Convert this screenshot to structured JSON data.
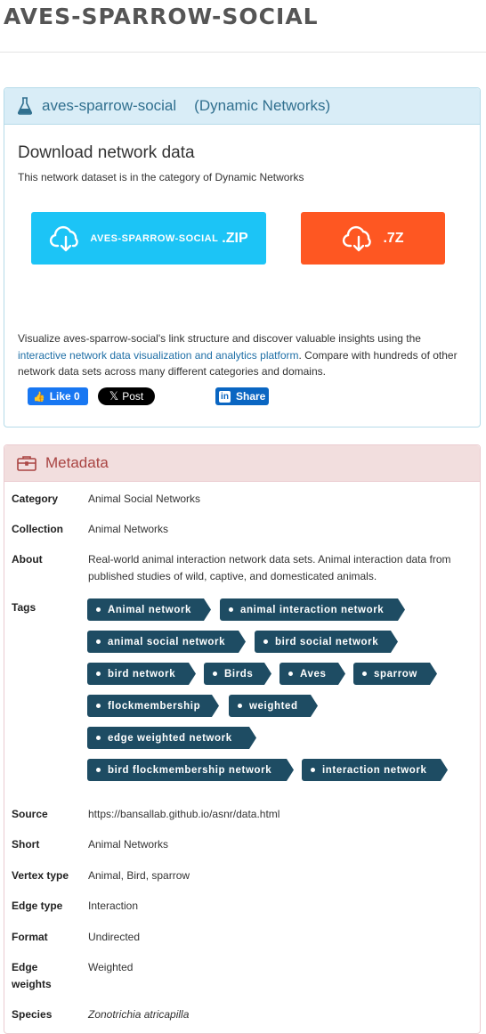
{
  "page": {
    "title": "AVES-SPARROW-SOCIAL"
  },
  "download": {
    "header_name": "aves-sparrow-social",
    "header_category": "(Dynamic Networks)",
    "title": "Download network data",
    "description": "This network dataset is in the category of Dynamic Networks",
    "zip_label": "AVES-SPARROW-SOCIAL",
    "zip_ext": ".ZIP",
    "sevenz_ext": ".7Z",
    "viz_prefix": "Visualize aves-sparrow-social's link structure and discover valuable insights using the",
    "viz_link": "interactive network data visualization and analytics platform",
    "viz_suffix": ". Compare with hundreds of other network data sets across many different categories and domains.",
    "fb_label": "Like 0",
    "tw_label": "Post",
    "li_label": "Share",
    "colors": {
      "zip": "#1cc4f6",
      "sevenz": "#fe5722"
    }
  },
  "metadata": {
    "header": "Metadata",
    "category_key": "Category",
    "category": "Animal Social Networks",
    "collection_key": "Collection",
    "collection": "Animal Networks",
    "about_key": "About",
    "about": "Real-world animal interaction network data sets. Animal interaction data from published studies of wild, captive, and domesticated animals.",
    "tags_key": "Tags",
    "tags": [
      "Animal network",
      "animal interaction network",
      "animal social network",
      "bird social network",
      "bird network",
      "Birds",
      "Aves",
      "sparrow",
      "flockmembership",
      "weighted",
      "edge weighted network",
      "bird flockmembership network",
      "interaction network"
    ],
    "source_key": "Source",
    "source": "https://bansallab.github.io/asnr/data.html",
    "short_key": "Short",
    "short": "Animal Networks",
    "vertex_key": "Vertex type",
    "vertex": "Animal, Bird, sparrow",
    "edge_key": "Edge type",
    "edge": "Interaction",
    "format_key": "Format",
    "format": "Undirected",
    "weights_key": "Edge weights",
    "weights": "Weighted",
    "species_key": "Species",
    "species": "Zonotrichia atricapilla"
  }
}
